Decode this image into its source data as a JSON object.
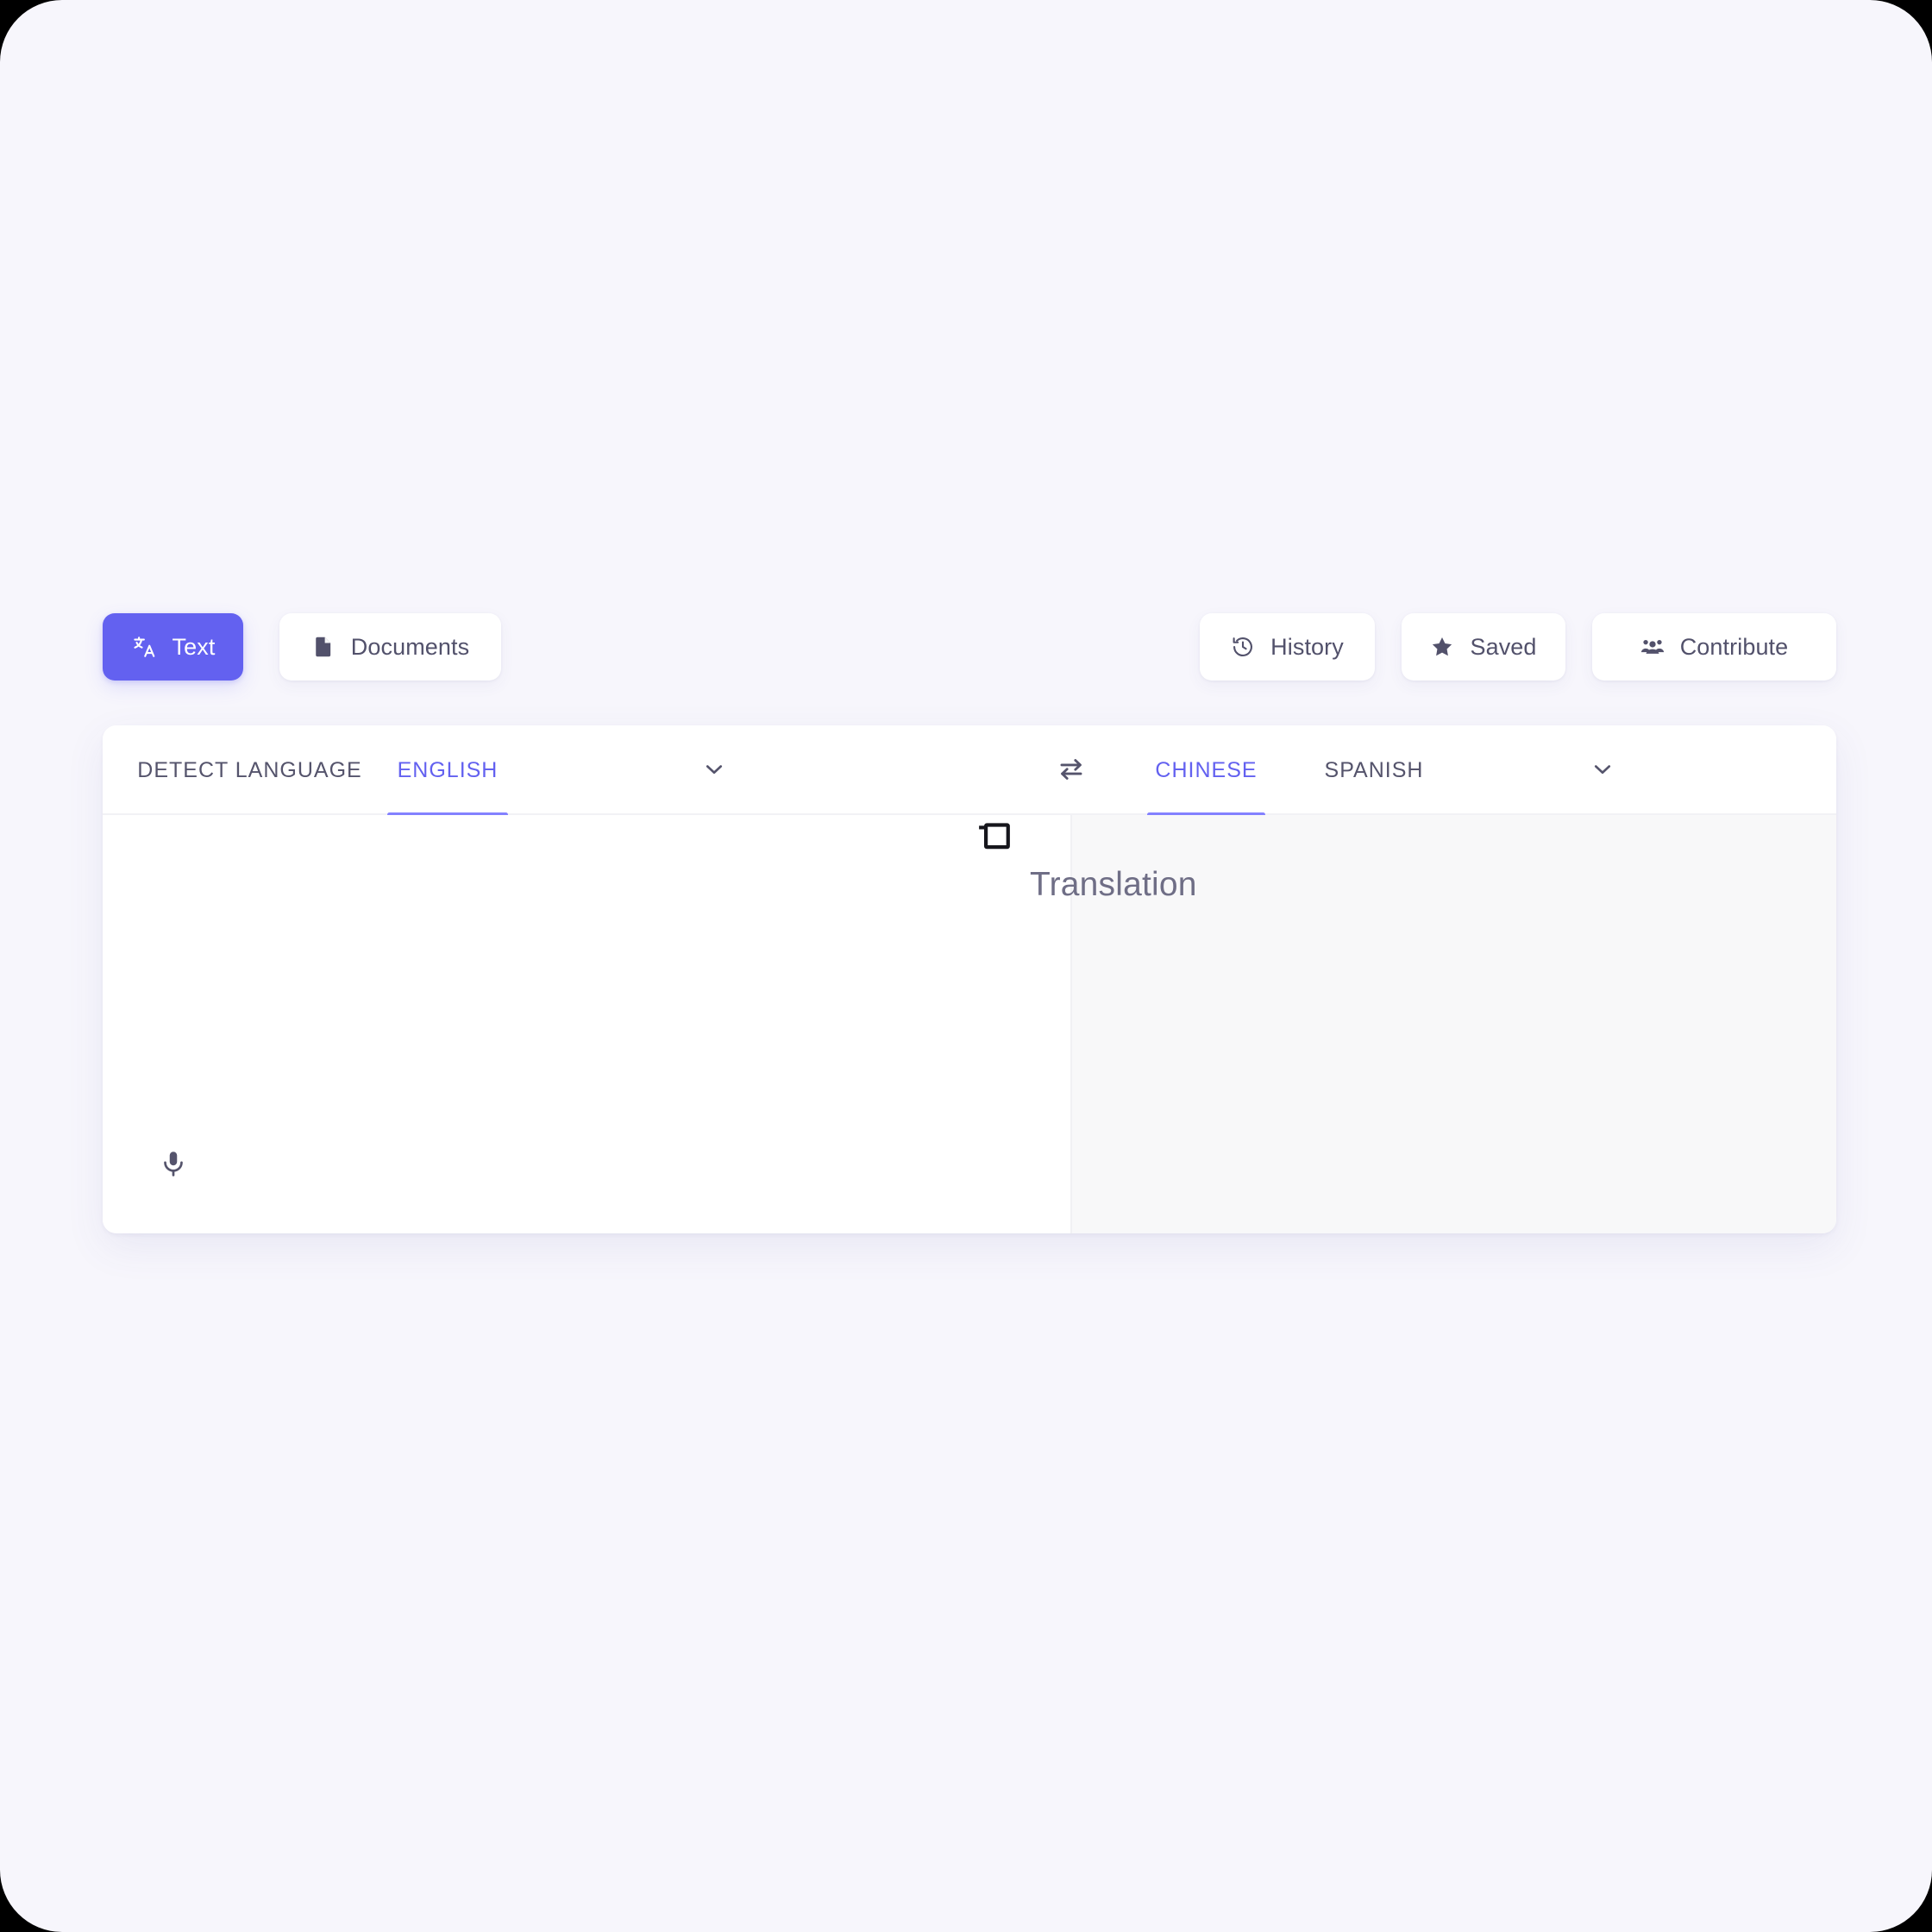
{
  "theme": {
    "page_background": "#f7f6fc",
    "accent": "#6361f0",
    "accent_underline": "#8381ff",
    "card_background": "#ffffff",
    "target_pane_background": "#f8f8f9",
    "text_muted": "#55546c"
  },
  "toolbar": {
    "left_buttons": [
      {
        "label": "Text",
        "icon": "translate-icon",
        "active": true
      },
      {
        "label": "Documents",
        "icon": "document-icon",
        "active": false
      }
    ],
    "right_buttons": [
      {
        "label": "History",
        "icon": "history-clock-icon"
      },
      {
        "label": "Saved",
        "icon": "star-icon"
      },
      {
        "label": "Contribute",
        "icon": "people-group-icon"
      }
    ]
  },
  "translator": {
    "source": {
      "tabs": [
        {
          "label": "DETECT LANGUAGE",
          "active": false
        },
        {
          "label": "ENGLISH",
          "active": true
        }
      ],
      "dropdown_icon": "chevron-down-icon",
      "input_value": "",
      "input_placeholder": "",
      "mic_icon": "microphone-icon"
    },
    "swap_icon": "swap-arrows-icon",
    "target": {
      "tabs": [
        {
          "label": "CHINESE",
          "active": true
        },
        {
          "label": "SPANISH",
          "active": false
        }
      ],
      "dropdown_icon": "chevron-down-icon",
      "copy_icon": "copy-icon",
      "translation_text": "Translation"
    }
  }
}
